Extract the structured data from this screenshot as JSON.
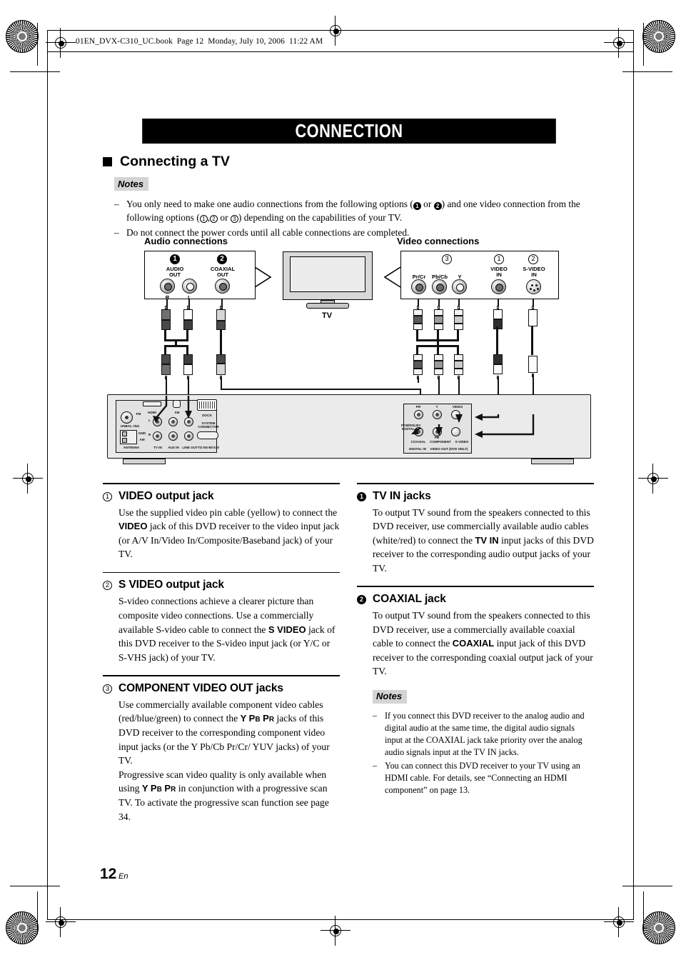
{
  "header": {
    "file_line": "01EN_DVX-C310_UC.book  Page 12  Monday, July 10, 2006  11:22 AM"
  },
  "banner": {
    "title": "CONNECTION"
  },
  "section": {
    "title": "Connecting a TV"
  },
  "notes_top": {
    "label": "Notes",
    "items": [
      "You only need to make one audio connections from the following options (❶ or ❷) and one video connection from the following options (①,② or ③) depending on the capabilities of your TV.",
      "Do not connect the power cords until all cable connections are completed."
    ]
  },
  "diagram": {
    "audio_label": "Audio connections",
    "video_label": "Video connections",
    "tv_caption": "TV",
    "audio_panel": {
      "badge1": "1",
      "badge2": "2",
      "group1_label": "AUDIO\nOUT",
      "group2_label": "COAXIAL\nOUT",
      "jack_r": "R",
      "jack_l": "L"
    },
    "video_panel": {
      "badge3": "3",
      "badge1": "1",
      "badge2": "2",
      "jack_prcr": "Pr/Cr",
      "jack_pbcb": "Pb/Cb",
      "jack_y": "Y",
      "jack_video_in": "VIDEO\nIN",
      "jack_svideo_in": "S-VIDEO\nIN"
    },
    "unit": {
      "hdmi": "HDMI",
      "xm": "XM",
      "dock": "DOCK",
      "system_connector": "SYSTEM\nCONNECTOR",
      "to_ns": "TO NS-BVX30",
      "antenna": "ANTENNA",
      "gnd": "GND",
      "am": "AM",
      "fm": "FM",
      "unbal": "UNBAL.75Ω",
      "tv_in": "TV IN",
      "aux_in": "AUX IN",
      "line_out": "LINE OUT",
      "ch_r": "R",
      "ch_l": "L",
      "coaxial": "COAXIAL",
      "digital_in": "DIGITAL IN",
      "pcm_dolby": "PCM/DOLBY\nDIGITAL",
      "pr": "PR",
      "pb": "PB",
      "y": "Y",
      "video": "VIDEO",
      "svideo": "S-VIDEO",
      "component": "COMPONENT",
      "video_out": "VIDEO OUT (DVD ONLY)"
    }
  },
  "column_left": [
    {
      "badge": "①",
      "badge_type": "circle",
      "title": "VIDEO output jack",
      "paragraphs": [
        "Use the supplied video pin cable (yellow) to connect the VIDEO jack of this DVD receiver to the video input jack (or A/V In/Video In/Composite/Baseband jack) of your TV."
      ]
    },
    {
      "badge": "②",
      "badge_type": "circle",
      "title": "S VIDEO output jack",
      "paragraphs": [
        "S-video connections achieve a clearer picture than composite video connections. Use a commercially available S-video cable to connect the S VIDEO jack of this DVD receiver to the S-video input jack (or Y/C or S-VHS jack) of your TV."
      ]
    },
    {
      "badge": "③",
      "badge_type": "circle",
      "title": "COMPONENT VIDEO OUT jacks",
      "paragraphs": [
        "Use commercially available component video cables (red/blue/green) to connect the Y PB PR jacks of this DVD receiver to the corresponding component video input jacks (or the Y Pb/Cb Pr/Cr/ YUV jacks) of your TV.",
        "Progressive scan video quality is only available when using Y PB PR in conjunction with a progressive scan TV. To activate the progressive scan function see page 34."
      ]
    }
  ],
  "column_right": [
    {
      "badge": "1",
      "badge_type": "filled",
      "title": "TV IN jacks",
      "paragraphs": [
        "To output TV sound from the speakers connected to this DVD receiver, use commercially available audio cables (white/red) to connect the TV IN input jacks of this DVD receiver to the corresponding audio output jacks of your TV."
      ]
    },
    {
      "badge": "2",
      "badge_type": "filled",
      "title": "COAXIAL jack",
      "paragraphs": [
        "To output TV sound from the speakers connected to this DVD receiver, use a commercially available coaxial cable to connect the COAXIAL input jack of this DVD receiver to the corresponding coaxial output jack of your TV."
      ]
    }
  ],
  "notes_bottom": {
    "label": "Notes",
    "items": [
      "If you connect this DVD receiver to the analog audio and digital audio at the same time, the digital audio signals input at the COAXIAL jack take priority over the analog audio signals input at the TV IN jacks.",
      "You can connect this DVD receiver to your TV using an HDMI cable. For details, see “Connecting an HDMI component” on page 13."
    ]
  },
  "footer": {
    "page_number": "12",
    "language": "En"
  },
  "colors": {
    "banner_bg": "#000000",
    "banner_fg": "#ffffff",
    "notes_tag_bg": "#d4d4d4"
  }
}
